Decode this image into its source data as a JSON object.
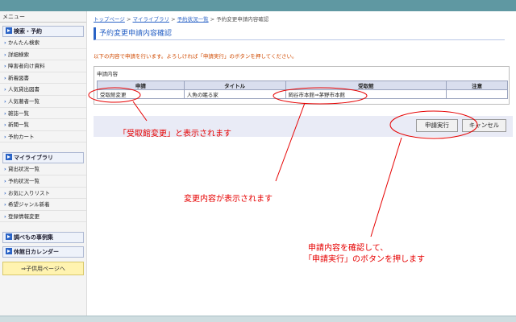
{
  "sidebar": {
    "menu_label": "メニュー",
    "sections": [
      {
        "title": "検索・予約",
        "icon": "play-icon",
        "items": [
          "かんたん検索",
          "詳細検索",
          "障害者向け資料",
          "新着図書",
          "人気貸出図書",
          "人気著者一覧",
          "雑誌一覧",
          "新聞一覧",
          "予約カート"
        ]
      },
      {
        "title": "マイライブラリ",
        "icon": "play-icon",
        "items": [
          "貸出状況一覧",
          "予約状況一覧",
          "お気に入りリスト",
          "希望ジャンル新着",
          "登録情報変更"
        ]
      },
      {
        "title": "調べもの事例集",
        "icon": "play-icon",
        "items": []
      },
      {
        "title": "休館日カレンダー",
        "icon": "play-icon",
        "items": []
      }
    ],
    "kids_link": "⇒子供用ページへ"
  },
  "breadcrumb": {
    "items": [
      "トップページ",
      "マイライブラリ",
      "予約状況一覧"
    ],
    "separator": ">",
    "current": "予約変更申請内容確認"
  },
  "page": {
    "title": "予約変更申請内容確認",
    "instruction": "以下の内容で申請を行います。よろしければ「申請実行」のボタンを押してください。",
    "section_label": "申請内容"
  },
  "table": {
    "headers": [
      "申請",
      "タイトル",
      "受取館",
      "注意"
    ],
    "rows": [
      [
        "受取館変更",
        "人魚の眠る家",
        "岡谷市本館⇒茅野市本館",
        ""
      ]
    ]
  },
  "buttons": {
    "submit": "申請実行",
    "cancel": "キャンセル"
  },
  "annotations": {
    "a1": "「受取館変更」と表示されます",
    "a2": "変更内容が表示されます",
    "a3_line1": "申請内容を確認して、",
    "a3_line2": "「申請実行」のボタンを押します"
  },
  "colors": {
    "topbar": "#5f98a2",
    "accent": "#2a63c6",
    "annotation": "#e60000",
    "instruction": "#d04a00"
  }
}
